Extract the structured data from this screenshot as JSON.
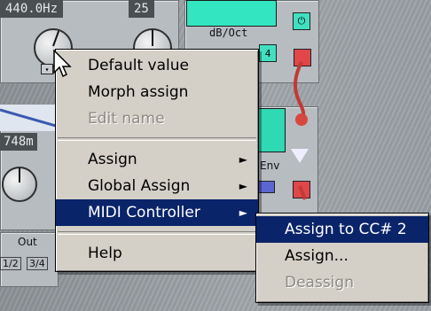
{
  "modules": {
    "frequency_readout": "440.0Hz",
    "second_readout": "25",
    "slope_label": "dB/Oct",
    "value_4": "4",
    "time_readout": "748m",
    "env_label": "Env",
    "out_label": "Out",
    "out_channels": [
      "1/2",
      "3/4"
    ]
  },
  "context_menu": {
    "items": [
      {
        "label": "Default value",
        "enabled": true
      },
      {
        "label": "Morph assign",
        "enabled": true
      },
      {
        "label": "Edit name",
        "enabled": false
      },
      {
        "label": "Assign",
        "enabled": true,
        "submenu": true
      },
      {
        "label": "Global Assign",
        "enabled": true,
        "submenu": true
      },
      {
        "label": "MIDI Controller",
        "enabled": true,
        "submenu": true,
        "selected": true
      },
      {
        "label": "Help",
        "enabled": true
      }
    ],
    "arrow_glyph": "►"
  },
  "submenu": {
    "items": [
      {
        "label": "Assign to CC# 2",
        "enabled": true,
        "selected": true
      },
      {
        "label": "Assign...",
        "enabled": true
      },
      {
        "label": "Deassign",
        "enabled": false
      }
    ]
  },
  "colors": {
    "menu_bg": "#d4d0c8",
    "highlight": "#0a246a",
    "scope": "#33e6c1",
    "cable": "#d8473f"
  }
}
